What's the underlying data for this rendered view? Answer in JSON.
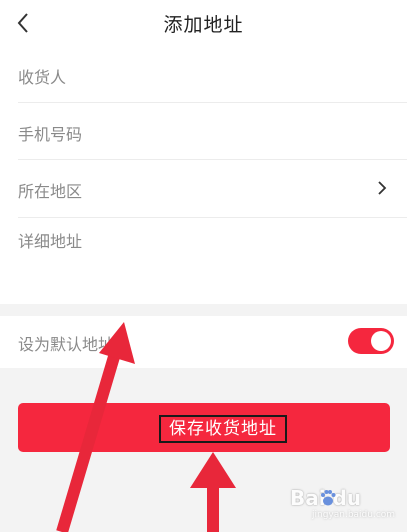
{
  "header": {
    "back_icon": "chevron-left-icon",
    "title": "添加地址"
  },
  "form": {
    "fields": [
      {
        "label": "收货人"
      },
      {
        "label": "手机号码"
      },
      {
        "label": "所在地区",
        "icon": "chevron-right-icon"
      },
      {
        "label": "详细地址"
      }
    ]
  },
  "default_address": {
    "label": "设为默认地址",
    "enabled": true
  },
  "save_button": {
    "label": "保存收货地址"
  },
  "watermark": {
    "logo": "Bai du",
    "sub": "jingyan.baidu.com"
  },
  "colors": {
    "accent": "#f5273e",
    "annotation_arrow": "#e8273a",
    "background": "#f3f3f3"
  }
}
